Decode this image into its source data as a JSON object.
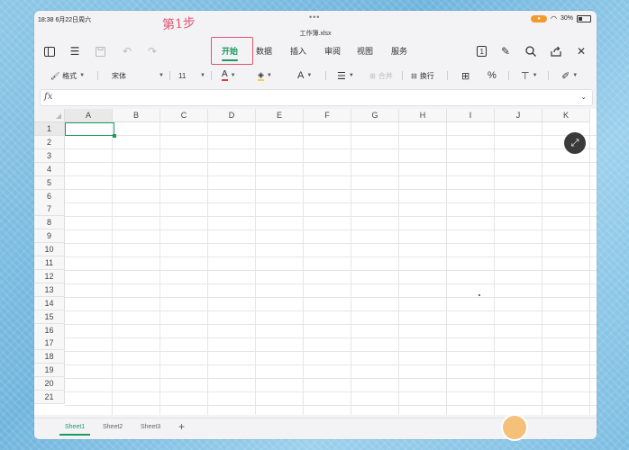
{
  "status": {
    "time": "18:38",
    "date": "6月22日周六",
    "battery": "30%"
  },
  "file": {
    "name": "工作簿.xlsx"
  },
  "annotation": "第1步",
  "tabs": [
    {
      "label": "开始",
      "active": true
    },
    {
      "label": "数据"
    },
    {
      "label": "插入"
    },
    {
      "label": "审阅"
    },
    {
      "label": "视图"
    },
    {
      "label": "服务"
    }
  ],
  "format": {
    "format_label": "格式",
    "font": "宋体",
    "size": "11",
    "merge_label": "合并",
    "wrap_label": "换行"
  },
  "formula": {
    "fx_label": "fx",
    "value": ""
  },
  "columns": [
    "A",
    "B",
    "C",
    "D",
    "E",
    "F",
    "G",
    "H",
    "I",
    "J",
    "K"
  ],
  "rows": [
    "1",
    "2",
    "3",
    "4",
    "5",
    "6",
    "7",
    "8",
    "9",
    "10",
    "11",
    "12",
    "13",
    "14",
    "15",
    "16",
    "17",
    "18",
    "19",
    "20",
    "21"
  ],
  "selection": {
    "cell": "A1"
  },
  "sheets": [
    "Sheet1",
    "Sheet2",
    "Sheet3"
  ],
  "active_sheet": "Sheet1",
  "colors": {
    "accent": "#1c9a5f",
    "annotation": "#e0556f",
    "mic": "#f29a2e"
  }
}
